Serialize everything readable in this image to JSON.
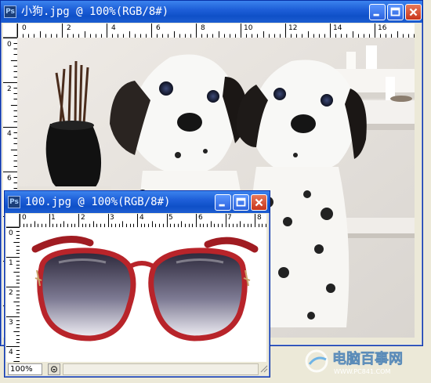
{
  "main_window": {
    "title": "小狗.jpg @ 100%(RGB/8#)",
    "ruler_h_labels": [
      "0",
      "2",
      "4",
      "6",
      "8",
      "10",
      "12",
      "14",
      "16"
    ],
    "ruler_v_labels": [
      "0",
      "2",
      "4",
      "6"
    ]
  },
  "sub_window": {
    "title": "100.jpg @ 100%(RGB/8#)",
    "ruler_h_labels": [
      "0",
      "1",
      "2",
      "3",
      "4",
      "5",
      "6",
      "7",
      "8"
    ],
    "ruler_v_labels": [
      "0",
      "1",
      "2",
      "3",
      "4"
    ],
    "zoom": "100%"
  },
  "watermark": {
    "brand": "电脑百事网",
    "url": "WWW.PC841.COM"
  },
  "colors": {
    "titlebar": "#0f50c8",
    "frame_red": "#b8242a",
    "close_button": "#c8351b"
  }
}
